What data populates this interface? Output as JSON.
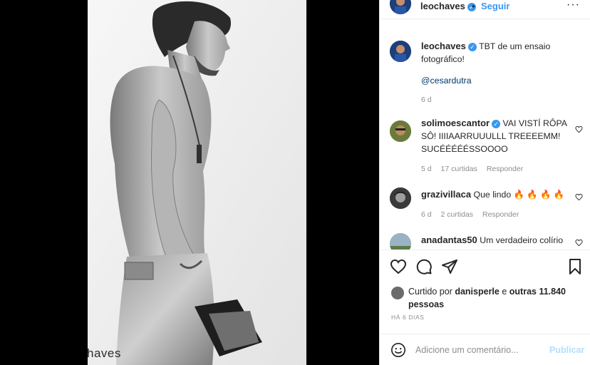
{
  "post": {
    "photo_caption_text": "haves",
    "header": {
      "username": "leochaves",
      "separator": "•",
      "follow_label": "Seguir",
      "more_label": "···"
    },
    "caption": {
      "username": "leochaves",
      "text": "TBT de um ensaio fotográfico!",
      "mention": "@cesardutra",
      "time": "6 d"
    },
    "comments": [
      {
        "username": "solimoescantor",
        "verified": true,
        "text": "VAI VISTÍ RÔPA SÔ! IIIIAARRUUULLL TREEEEMM! SUCÉÉÉÉÉSSOOOO",
        "time": "5 d",
        "likes": "17 curtidas",
        "reply": "Responder"
      },
      {
        "username": "grazivillaca",
        "verified": false,
        "text": "Que lindo 🔥 🔥 🔥 🔥",
        "time": "6 d",
        "likes": "2 curtidas",
        "reply": "Responder"
      },
      {
        "username": "anadantas50",
        "verified": false,
        "text": "Um verdadeiro colírio",
        "time": "",
        "likes": "",
        "reply": ""
      }
    ],
    "liked_by": {
      "prefix": "Curtido por",
      "user": "danisperle",
      "middle": "e",
      "others": "outras 11.840 pessoas"
    },
    "timestamp": "HÁ 6 DIAS",
    "composer": {
      "placeholder": "Adicione um comentário...",
      "publish_label": "Publicar"
    }
  },
  "colors": {
    "accent": "#3897f0",
    "publish_disabled": "#b2dffc",
    "muted": "#8e8e8e",
    "text": "#262626"
  },
  "icons": {
    "verified": "verified-badge-icon",
    "like": "heart-icon",
    "comment": "comment-bubble-icon",
    "share": "paper-plane-icon",
    "save": "bookmark-icon",
    "emoji": "smiley-icon"
  }
}
